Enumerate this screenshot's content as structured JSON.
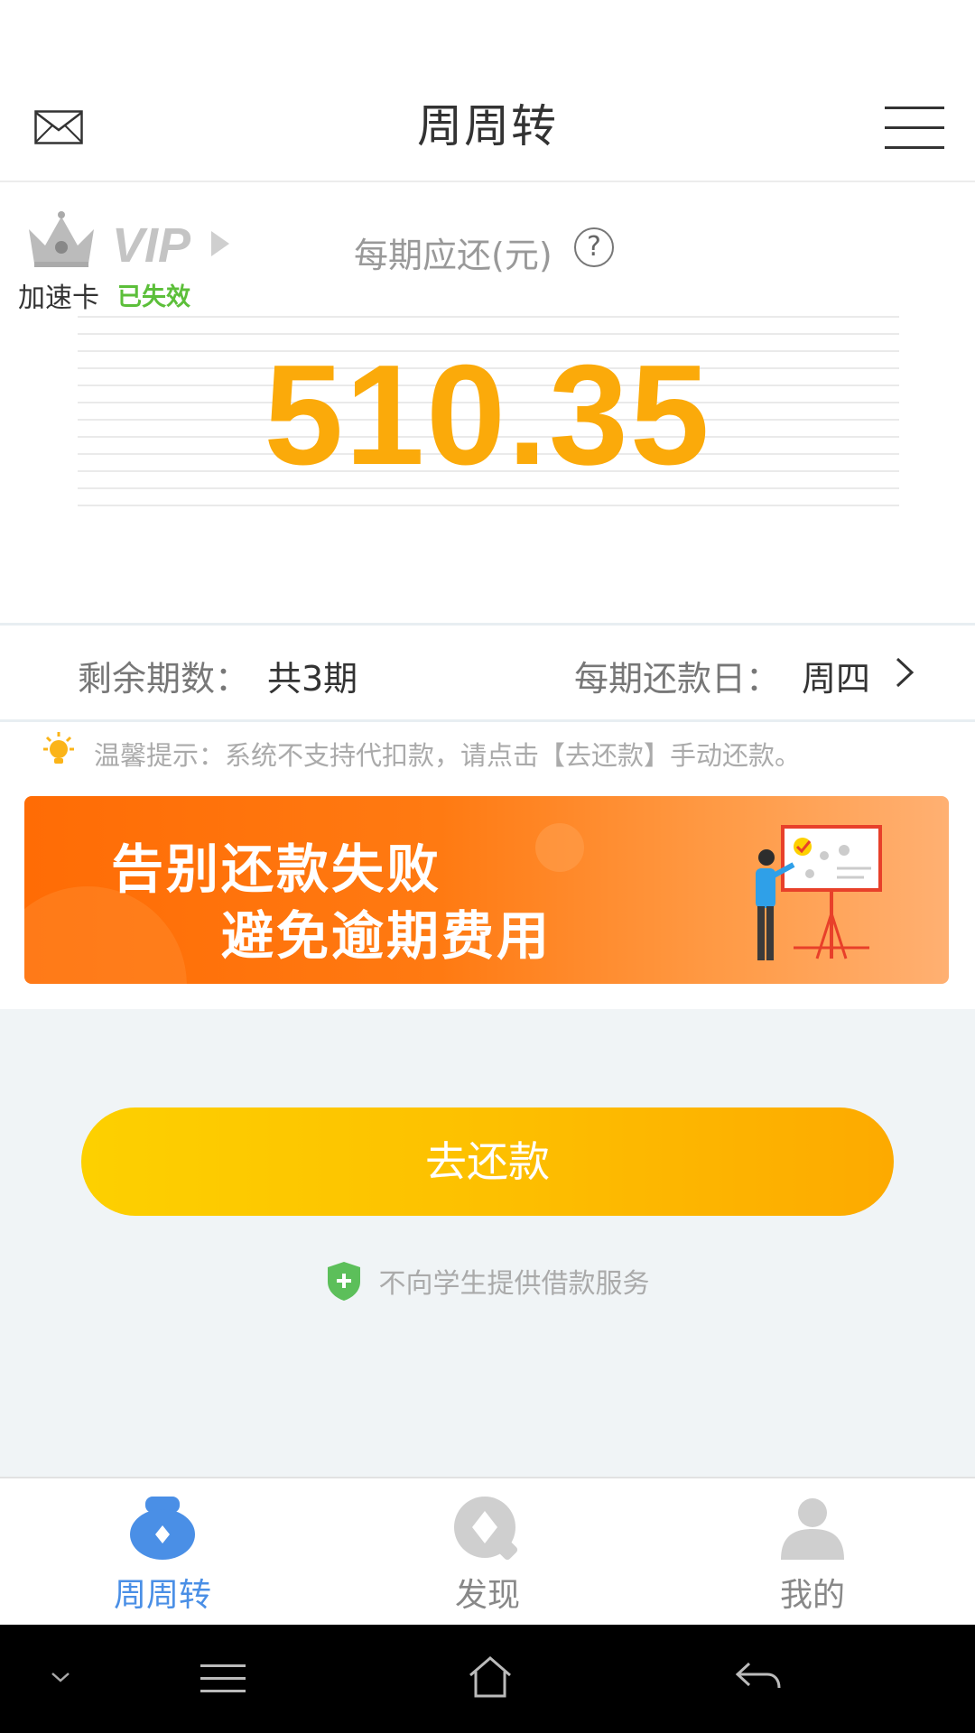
{
  "header": {
    "title": "周周转",
    "mail_icon": "envelope-icon",
    "menu_icon": "hamburger-menu-icon"
  },
  "summary": {
    "vip_badge": "VIP",
    "vip_label": "加速卡",
    "vip_status": "已失效",
    "amount_label": "每期应还(元)",
    "help_icon_text": "?",
    "amount": "510.35",
    "amount_color": "#fbaa0a"
  },
  "info": {
    "remaining_label": "剩余期数：",
    "remaining_value": "共3期",
    "day_label": "每期还款日：",
    "day_value": "周四"
  },
  "tip": {
    "text": "温馨提示：系统不支持代扣款，请点击【去还款】手动还款。"
  },
  "banner": {
    "line1": "告别还款失败",
    "line2": "避免逾期费用"
  },
  "actions": {
    "pay_label": "去还款"
  },
  "notice": {
    "text": "不向学生提供借款服务"
  },
  "tabs": [
    {
      "label": "周周转",
      "icon": "money-bag-icon",
      "active": true
    },
    {
      "label": "发现",
      "icon": "discover-icon",
      "active": false
    },
    {
      "label": "我的",
      "icon": "profile-icon",
      "active": false
    }
  ],
  "colors": {
    "accent": "#fbaa0a",
    "tab_active": "#4a8fe6",
    "status_green": "#5cbf3a",
    "banner": "#ff6c05"
  }
}
